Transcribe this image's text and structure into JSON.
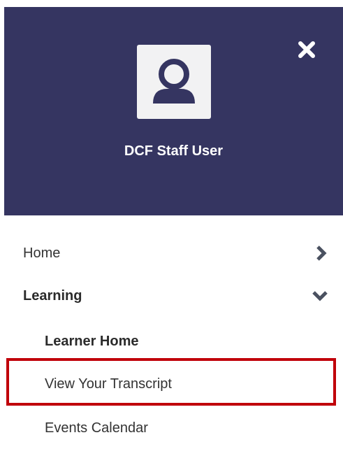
{
  "user": {
    "name": "DCF Staff User"
  },
  "icons": {
    "close": "close-icon",
    "avatar": "user-avatar-icon",
    "expand": "chevron-right-icon",
    "collapse": "chevron-down-icon"
  },
  "colors": {
    "header_bg": "#353561",
    "highlight_border": "#c0000a"
  },
  "nav": {
    "items": [
      {
        "label": "Home",
        "state": "collapsed"
      },
      {
        "label": "Learning",
        "state": "expanded"
      }
    ],
    "learning_subitems": [
      {
        "label": "Learner Home"
      },
      {
        "label": "View Your Transcript",
        "highlighted": true
      },
      {
        "label": "Events Calendar"
      }
    ]
  }
}
